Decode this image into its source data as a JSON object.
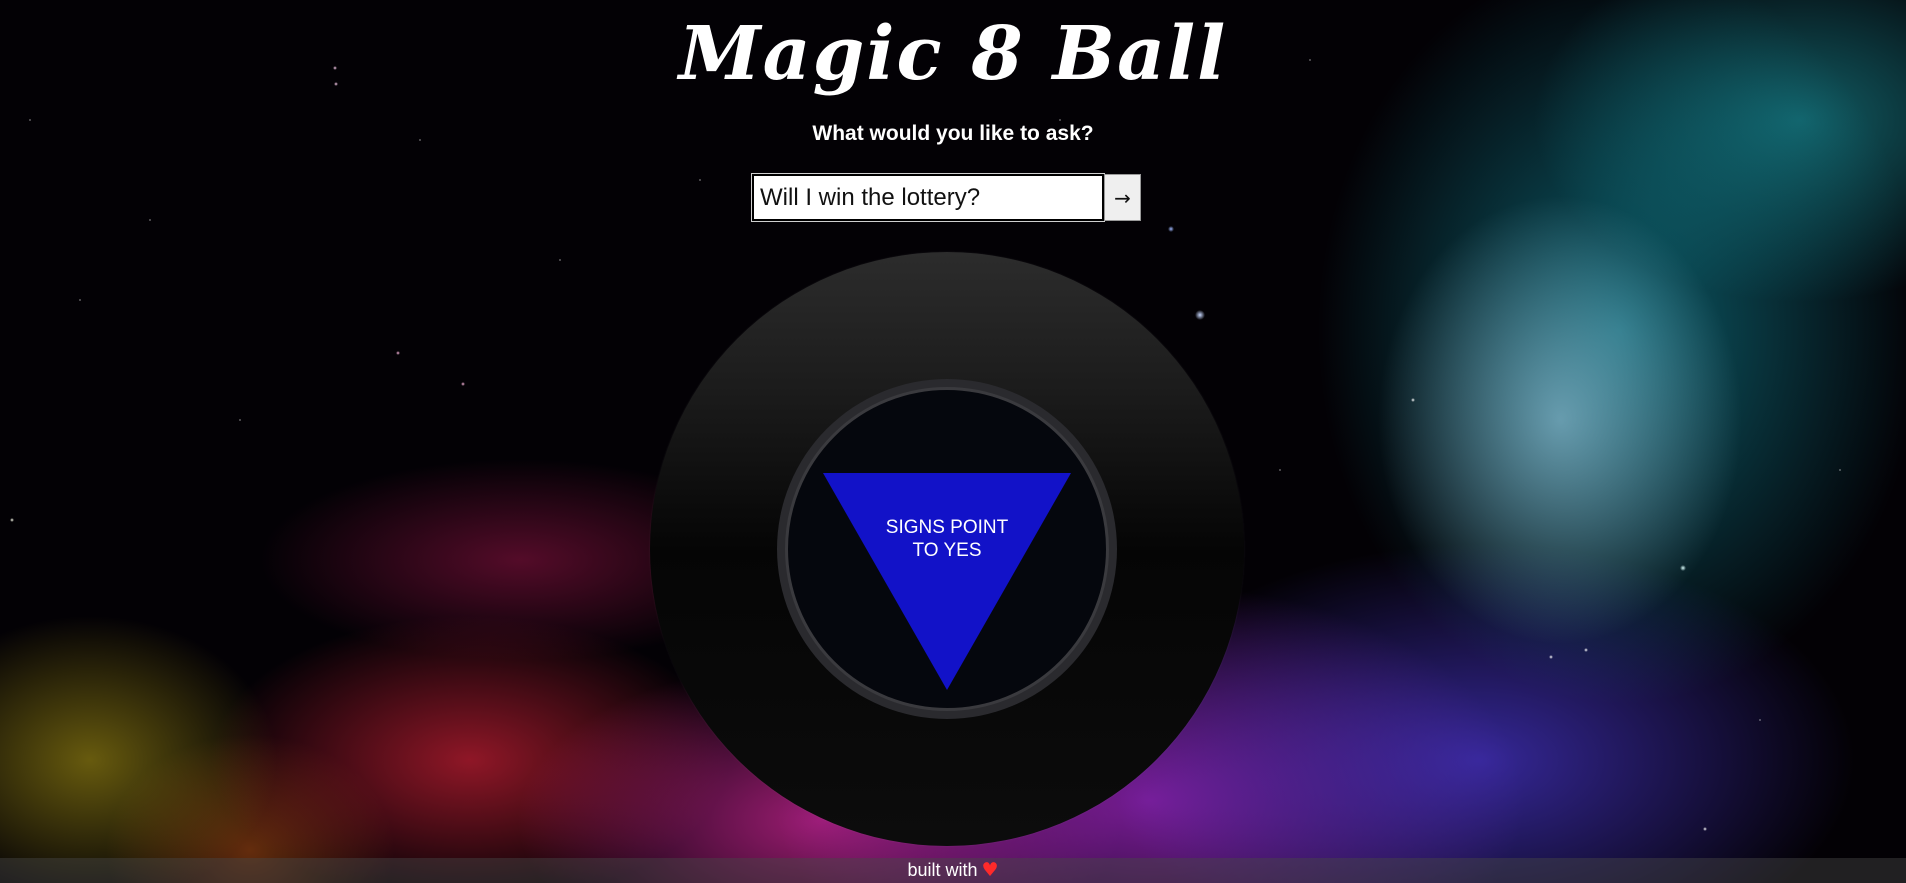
{
  "app": {
    "title": "Magic 8 Ball"
  },
  "prompt": {
    "text": "What would you like to ask?"
  },
  "question": {
    "value": "Will I win the lottery?",
    "submit_label": "→"
  },
  "ball": {
    "answer": "SIGNS POINT TO YES",
    "triangle_color": "#1212c8"
  },
  "footer": {
    "text": "built with",
    "icon": "heart-icon",
    "heart_color": "#ff2a2a"
  }
}
